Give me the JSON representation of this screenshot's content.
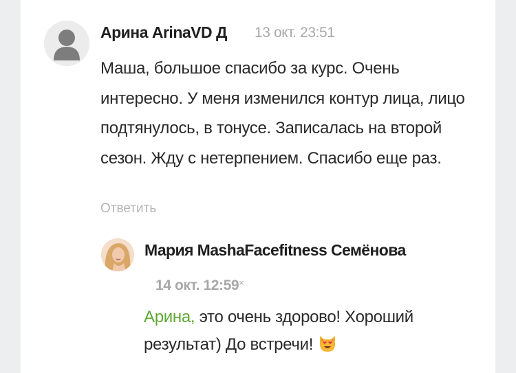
{
  "comment": {
    "author": "Арина ArinaVD Д",
    "time": "13 окт. 23:51",
    "text": "Маша, большое спасибо за курс. Очень интересно. У меня изменился контур лица, лицо подтянулось, в тонусе. Записалась на второй сезон. Жду с нетерпением. Спасибо еще раз.",
    "reply_label": "Ответить",
    "avatar_icon": "default-user-avatar"
  },
  "reply": {
    "author": "Мария MashaFacefitness Семёнова",
    "time": "14 окт. 12:59",
    "close_mark": "×",
    "mention": "Арина,",
    "text": " это очень здорово! Хороший результат) До встречи!",
    "emoji_icon": "heart-eyes-cat-emoji",
    "avatar_icon": "profile-photo"
  },
  "colors": {
    "mention": "#5da832",
    "muted": "#a8a8a8",
    "background": "#eceeef"
  }
}
